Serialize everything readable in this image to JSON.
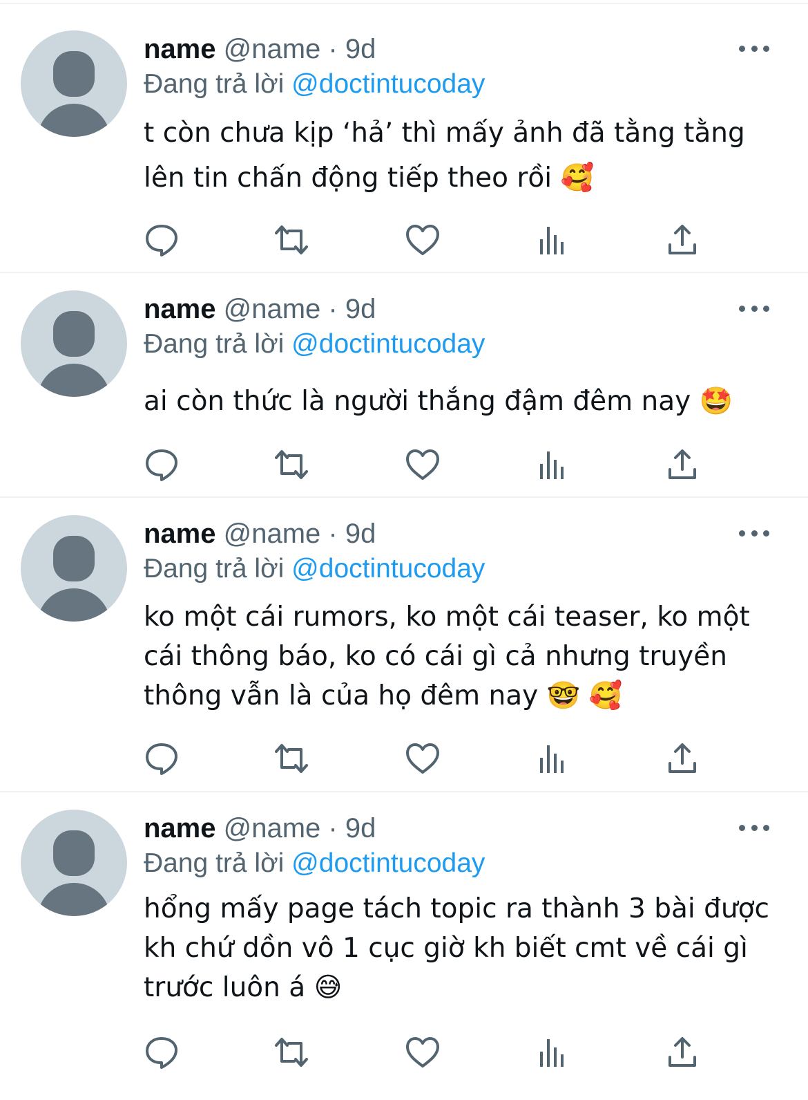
{
  "tweets": [
    {
      "display_name": "name",
      "handle_meta": "@name · 9d",
      "reply_prefix": "Đang trả lời",
      "reply_handle": "@doctintucoday",
      "text": "t còn chưa kịp ‘hả’ thì mấy ảnh đã tằng tằng\nlên tin chấn động tiếp theo rồi 🥰"
    },
    {
      "display_name": "name",
      "handle_meta": "@name · 9d",
      "reply_prefix": "Đang trả lời",
      "reply_handle": "@doctintucoday",
      "text": "ai còn thức là người thắng đậm đêm nay 🤩"
    },
    {
      "display_name": "name",
      "handle_meta": "@name · 9d",
      "reply_prefix": "Đang trả lời",
      "reply_handle": "@doctintucoday",
      "text": "ko một cái rumors, ko một cái teaser, ko một\ncái thông báo, ko có cái gì cả nhưng truyền\nthông vẫn là của họ đêm nay 🤓 🥰"
    },
    {
      "display_name": "name",
      "handle_meta": "@name · 9d",
      "reply_prefix": "Đang trả lời",
      "reply_handle": "@doctintucoday",
      "text": "hổng mấy page tách topic ra thành 3 bài được\nkh chứ dồn vô 1 cục giờ kh biết cmt về cái gì\ntrước luôn á 😅"
    }
  ],
  "icons": {
    "reply": "reply-icon",
    "retweet": "retweet-icon",
    "like": "like-icon",
    "views": "views-icon",
    "share": "share-icon",
    "more": "more-icon"
  },
  "colors": {
    "text": "#0f1419",
    "secondary": "#536471",
    "link": "#1d9bf0",
    "avatar_bg": "#ccd6dd",
    "avatar_fg": "#66757f",
    "divider": "#eff3f4"
  }
}
